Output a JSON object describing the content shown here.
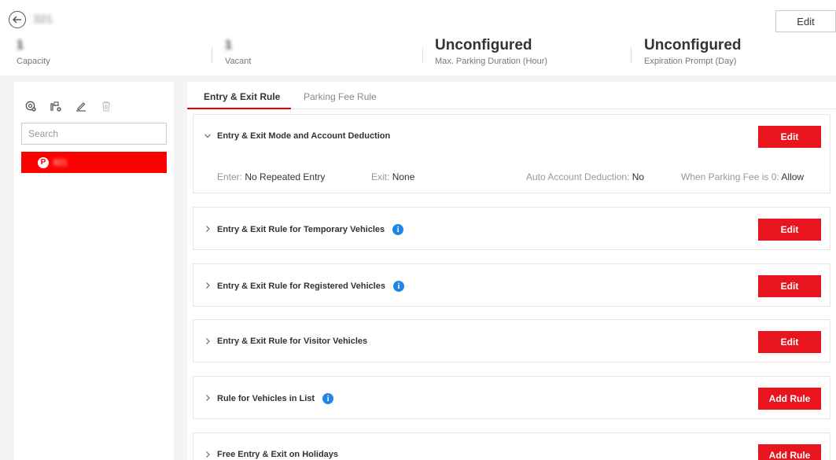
{
  "header": {
    "lot_name": "321",
    "edit_label": "Edit",
    "stats": [
      {
        "value": "1",
        "label": "Capacity"
      },
      {
        "value": "1",
        "label": "Vacant"
      },
      {
        "value": "Unconfigured",
        "label": "Max. Parking Duration (Hour)"
      },
      {
        "value": "Unconfigured",
        "label": "Expiration Prompt (Day)"
      }
    ]
  },
  "sidebar": {
    "toolbar_icons": [
      "add-parking-lot-icon",
      "add-entrance-icon",
      "edit-icon",
      "delete-icon"
    ],
    "search_placeholder": "Search",
    "items": [
      {
        "label": "321",
        "badge": "P"
      }
    ]
  },
  "tabs": [
    {
      "label": "Entry & Exit Rule",
      "active": true
    },
    {
      "label": "Parking Fee Rule",
      "active": false
    }
  ],
  "sections": [
    {
      "title": "Entry & Exit Mode and Account Deduction",
      "button": "Edit",
      "expanded": true,
      "details": [
        {
          "label": "Enter:",
          "value": "No Repeated Entry"
        },
        {
          "label": "Exit:",
          "value": "None"
        },
        {
          "label": "Auto Account Deduction:",
          "value": "No"
        },
        {
          "label": "When Parking Fee is 0:",
          "value": "Allow"
        }
      ]
    },
    {
      "title": "Entry & Exit Rule for Temporary Vehicles",
      "button": "Edit",
      "info": true
    },
    {
      "title": "Entry & Exit Rule for Registered Vehicles",
      "button": "Edit",
      "info": true
    },
    {
      "title": "Entry & Exit Rule for Visitor Vehicles",
      "button": "Edit",
      "info": false
    },
    {
      "title": "Rule for Vehicles in List",
      "button": "Add Rule",
      "info": true
    },
    {
      "title": "Free Entry & Exit on Holidays",
      "button": "Add Rule",
      "info": false
    }
  ],
  "colors": {
    "accent": "#e8141e",
    "info": "#1f86e8"
  }
}
